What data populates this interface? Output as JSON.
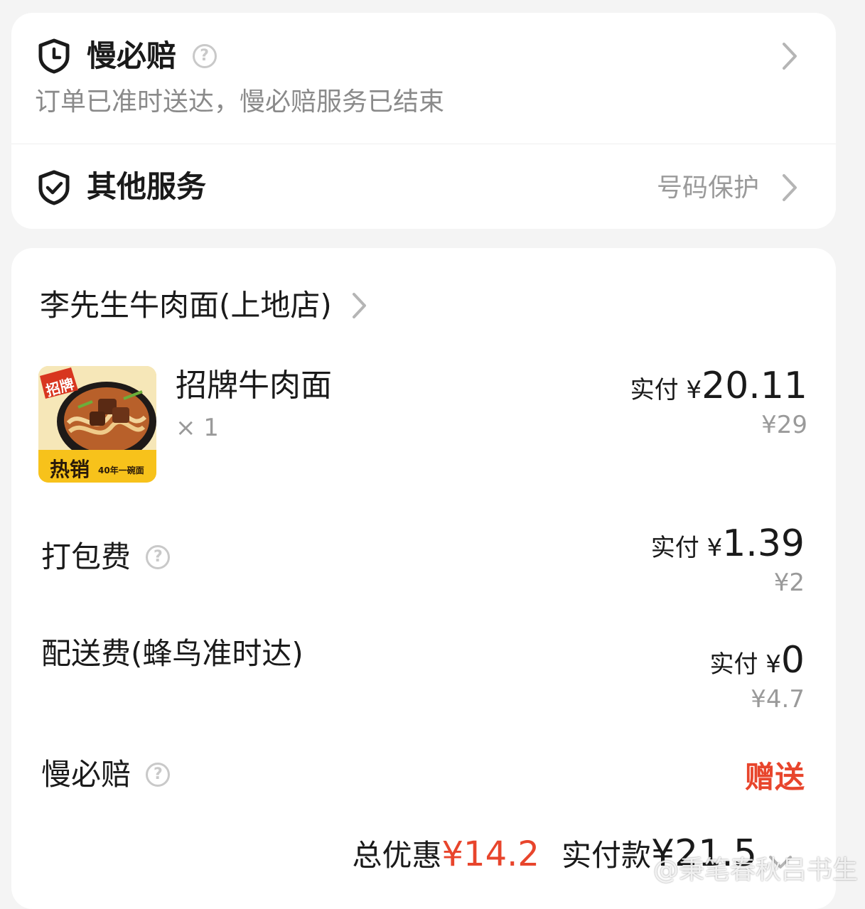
{
  "services": {
    "slow_compensation": {
      "title": "慢必赔",
      "help_icon": "?",
      "subtitle": "订单已准时送达，慢必赔服务已结束"
    },
    "other_services": {
      "title": "其他服务",
      "value": "号码保护"
    }
  },
  "order": {
    "shop_name": "李先生牛肉面(上地店)",
    "item": {
      "name": "招牌牛肉面",
      "quantity": "× 1",
      "pay_label": "实付 ¥",
      "pay_amount": "20.11",
      "original_price": "¥29",
      "thumb_badge": "招牌",
      "thumb_hot": "热销",
      "thumb_slogan": "40年一碗面"
    },
    "fees": [
      {
        "label": "打包费",
        "pay_label": "实付 ¥",
        "pay_amount": "1.39",
        "original_price": "¥2"
      },
      {
        "label": "配送费(蜂鸟准时达)",
        "pay_label": "实付 ¥",
        "pay_amount": "0",
        "original_price": "¥4.7"
      }
    ],
    "slow_comp": {
      "label": "慢必赔",
      "value": "赠送"
    },
    "summary": {
      "discount_label": "总优惠",
      "discount_amount": "¥14.2",
      "paid_label": "实付款",
      "paid_amount": "¥21.5"
    }
  },
  "watermark": "@秉笔春秋吕书生",
  "colors": {
    "background": "#f4f4f4",
    "card": "#ffffff",
    "accent_red": "#e8452c",
    "text_primary": "#1a1a1a",
    "text_secondary": "#9a9a9a"
  },
  "icons": [
    "clock-shield-icon",
    "check-shield-icon",
    "help-icon",
    "chevron-right-icon",
    "chevron-down-icon"
  ]
}
